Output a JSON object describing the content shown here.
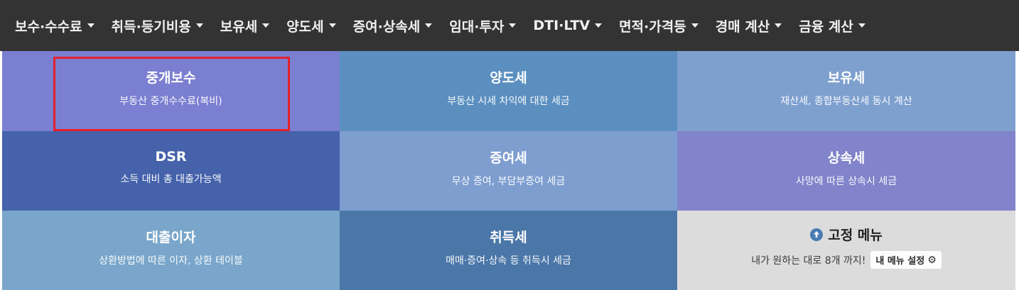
{
  "nav": {
    "items": [
      {
        "label": "보수·수수료"
      },
      {
        "label": "취득·등기비용"
      },
      {
        "label": "보유세"
      },
      {
        "label": "양도세"
      },
      {
        "label": "증여·상속세"
      },
      {
        "label": "임대·투자"
      },
      {
        "label": "DTI·LTV"
      },
      {
        "label": "면적·가격등"
      },
      {
        "label": "경매 계산"
      },
      {
        "label": "금융 계산"
      }
    ]
  },
  "tiles": [
    {
      "title": "중개보수",
      "desc": "부동산 중개수수료(복비)",
      "color": "#7b7fd1"
    },
    {
      "title": "양도세",
      "desc": "부동산 시세 차익에 대한 세금",
      "color": "#5b8fc0"
    },
    {
      "title": "보유세",
      "desc": "재산세, 종합부동산세 동시 계산",
      "color": "#7ea0cf"
    },
    {
      "title": "DSR",
      "desc": "소득 대비 총 대출가능액",
      "color": "#4562ab"
    },
    {
      "title": "증여세",
      "desc": "무상 증여, 부담부증여 세금",
      "color": "#7e9ed0"
    },
    {
      "title": "상속세",
      "desc": "사망에 따른 상속시 세금",
      "color": "#8184ca"
    },
    {
      "title": "대출이자",
      "desc": "상환방법에 따른 이자, 상환 테이블",
      "color": "#79a6ca"
    },
    {
      "title": "취득세",
      "desc": "매매·증여·상속 등 취득시 세금",
      "color": "#4b76a8"
    }
  ],
  "fixed_menu": {
    "title": "고정 메뉴",
    "desc": "내가 원하는 대로 8개 까지!",
    "button_label": "내 메뉴 설정",
    "icon": "arrow-up-circle-icon",
    "button_icon": "gear-icon",
    "color": "#dcdcdc"
  }
}
